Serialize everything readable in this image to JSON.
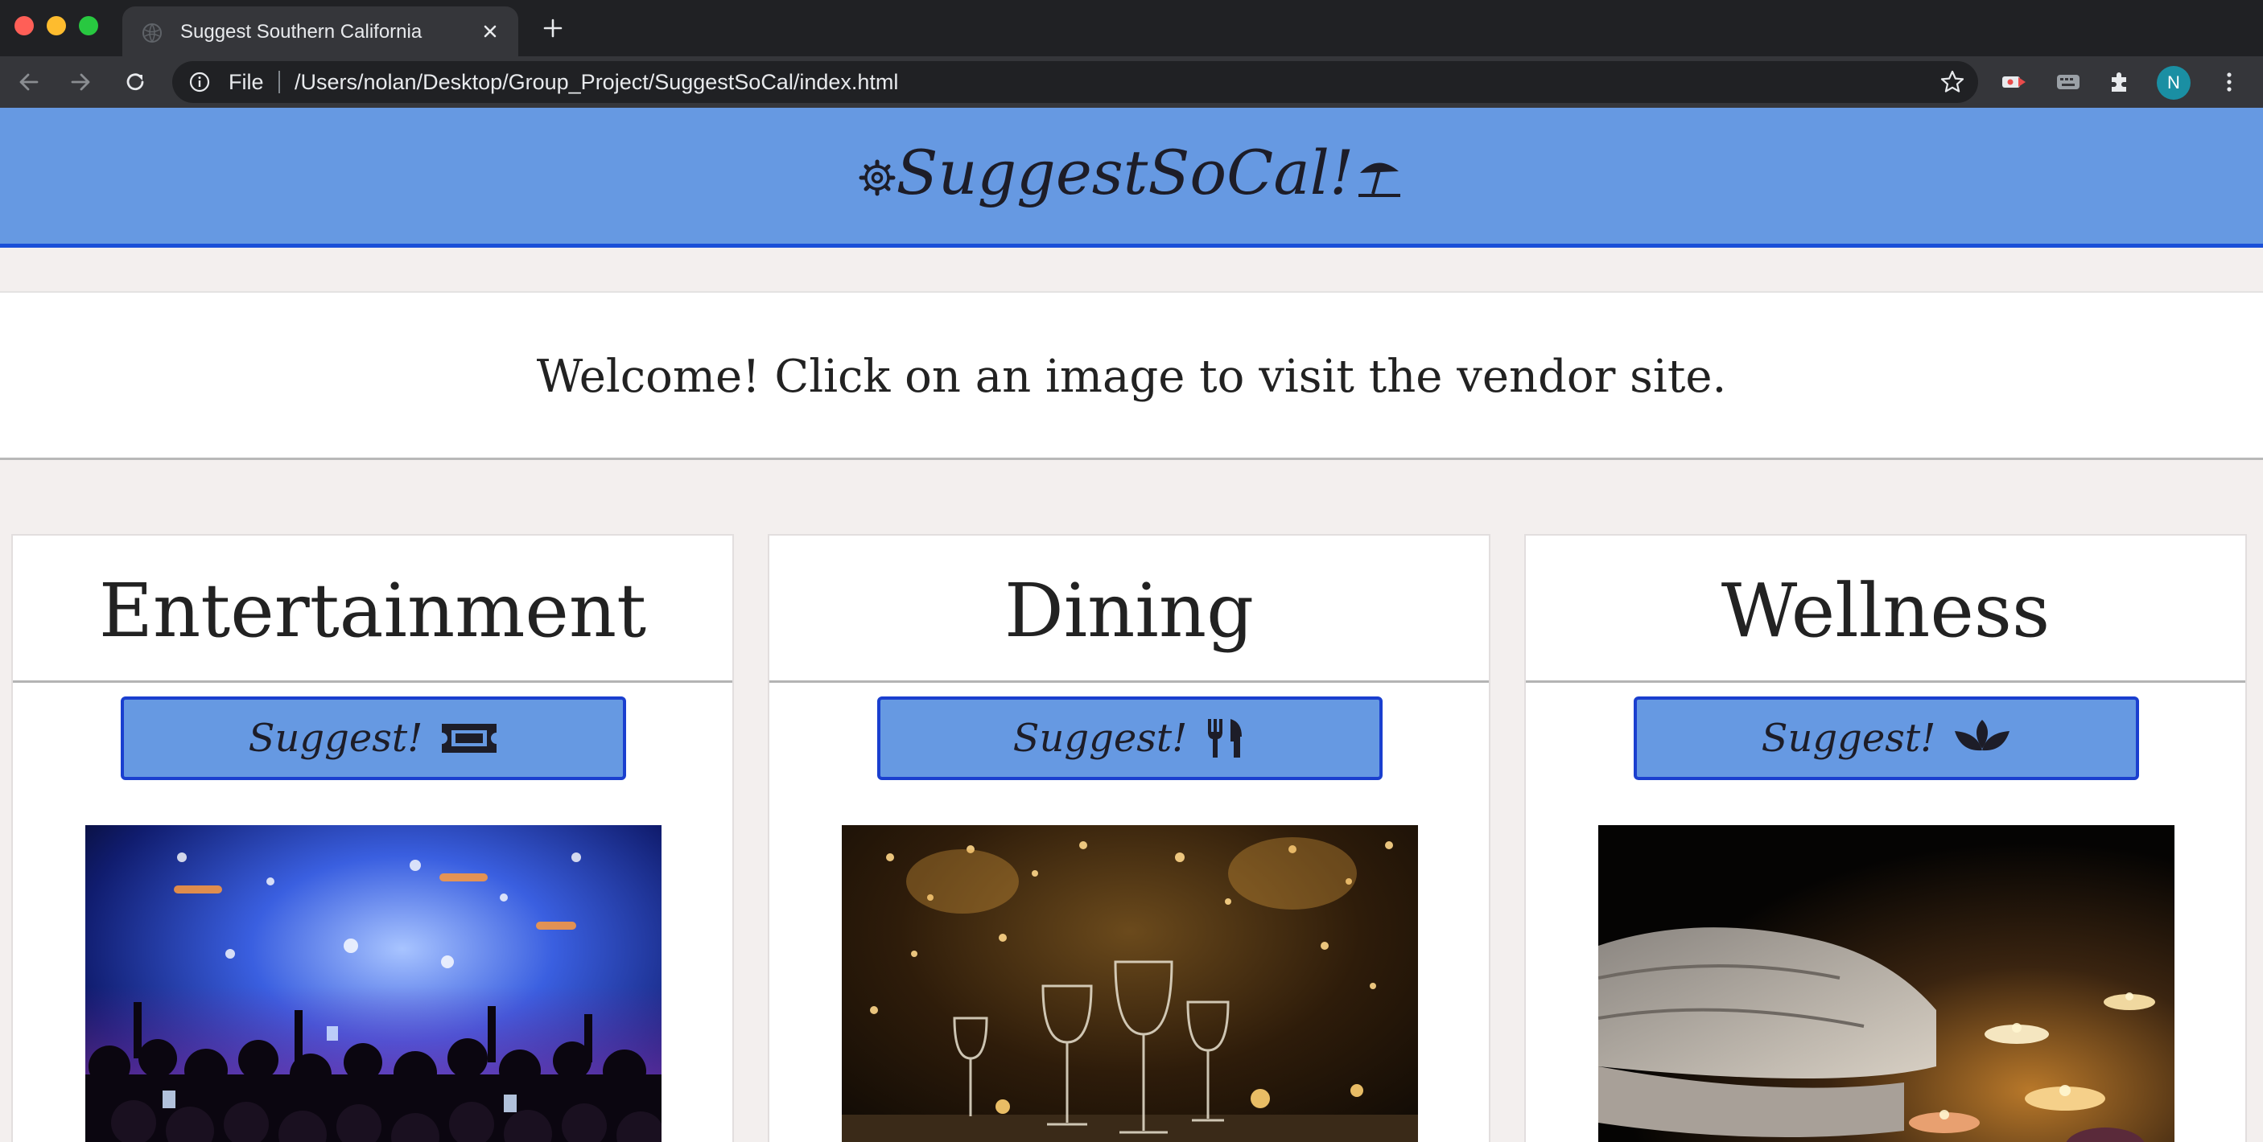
{
  "browser": {
    "tab_title": "Suggest Southern California",
    "scheme_label": "File",
    "url": "/Users/nolan/Desktop/Group_Project/SuggestSoCal/index.html",
    "profile_initial": "N"
  },
  "site": {
    "title": "SuggestSoCal!",
    "welcome": "Welcome! Click on an image to visit the vendor site.",
    "header_color": "#6699e2",
    "accent_color": "#1a3fcf"
  },
  "cards": [
    {
      "title": "Entertainment",
      "button_label": "Suggest!",
      "icon": "ticket-icon",
      "image": "concert-crowd-photo"
    },
    {
      "title": "Dining",
      "button_label": "Suggest!",
      "icon": "utensils-icon",
      "image": "restaurant-table-photo"
    },
    {
      "title": "Wellness",
      "button_label": "Suggest!",
      "icon": "spa-lotus-icon",
      "image": "spa-candles-photo"
    }
  ]
}
